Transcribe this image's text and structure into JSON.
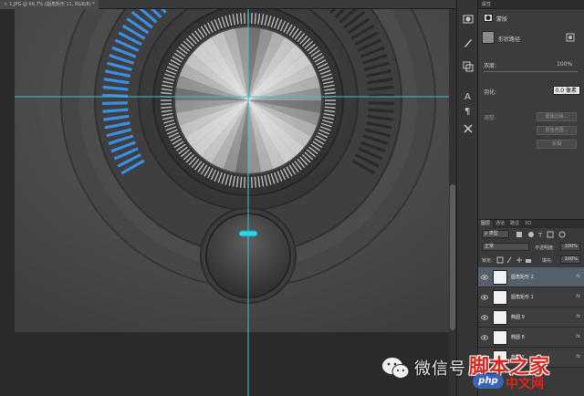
{
  "document": {
    "tab_title": "1.JPG @ 66.7% (圆角矩形 11, RGB/8) *"
  },
  "properties_panel": {
    "title": "属性",
    "mask_label": "蒙版",
    "shape_path_label": "形状路径",
    "density_label": "浓度:",
    "density_value": "100%",
    "feather_label": "羽化:",
    "feather_value": "0.0 像素",
    "refine_label": "调整:",
    "mask_edge_button": "蒙版边缘...",
    "color_range_button": "颜色范围...",
    "invert_button": "反相"
  },
  "layers_panel": {
    "tabs": [
      "图层",
      "通道",
      "路径",
      "3D"
    ],
    "filter_kind": "ρ 类型",
    "blend_mode": "正常",
    "opacity_label": "不透明度:",
    "opacity_value": "100%",
    "lock_label": "锁定:",
    "fill_label": "填充:",
    "fill_value": "100%",
    "layers": [
      {
        "name": "圆角矩形 2",
        "fx": "fx",
        "selected": true
      },
      {
        "name": "圆角矩形 1",
        "fx": "fx",
        "selected": false
      },
      {
        "name": "椭圆 9",
        "fx": "fx",
        "selected": false
      },
      {
        "name": "椭圆 8",
        "fx": "fx",
        "selected": false
      },
      {
        "name": "椭圆 7",
        "fx": "fx",
        "selected": false
      }
    ]
  },
  "watermark": {
    "wechat_text": "微信号",
    "site_name": "脚本之家",
    "site_badge": "php",
    "site_sub": "中文网"
  },
  "colors": {
    "accent_blue": "#3a8ee6",
    "cyan_indicator": "#2fd6e6",
    "guide_line": "#2ec7e0",
    "panel_bg": "#3c3c3c",
    "site_red": "#d7261e"
  },
  "icons": {
    "tools": [
      "mask-icon",
      "brush-icon",
      "layer-comp-icon",
      "type-icon",
      "paragraph-icon",
      "settings-icon"
    ]
  }
}
